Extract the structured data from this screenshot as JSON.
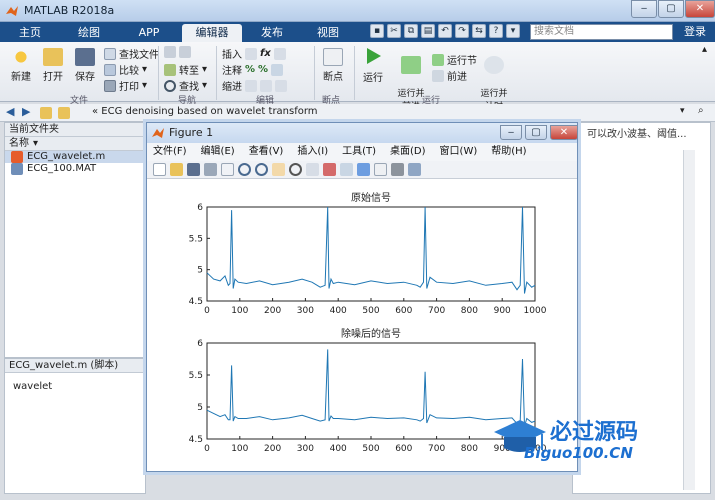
{
  "app": {
    "title": "MATLAB R2018a",
    "window_controls": [
      "‒",
      "▢",
      "✕"
    ]
  },
  "tabs": [
    {
      "label": "主页"
    },
    {
      "label": "绘图"
    },
    {
      "label": "APP"
    },
    {
      "label": "编辑器",
      "active": true
    },
    {
      "label": "发布"
    },
    {
      "label": "视图"
    }
  ],
  "search": {
    "placeholder": "搜索文档"
  },
  "login_label": "登录",
  "ribbon": {
    "file_group": {
      "new": "新建",
      "open": "打开",
      "save": "保存",
      "find_files": "查找文件",
      "compare": "比较",
      "print": "打印",
      "label": "文件"
    },
    "nav_group": {
      "goto": "转至",
      "find": "查找",
      "label": "导航"
    },
    "edit_group": {
      "insert": "插入",
      "comment": "注释",
      "indent": "缩进",
      "fx": "fx",
      "label": "编辑"
    },
    "breakpoint_group": {
      "breakpoint": "断点",
      "label": "断点"
    },
    "run_group": {
      "run": "运行",
      "run_advance": "运行并\n前进",
      "run_section": "运行节",
      "advance": "前进",
      "run_time": "运行并\n计时",
      "label": "运行"
    }
  },
  "address": {
    "path": "«  ECG denoising based on wavelet transform"
  },
  "left_panel": {
    "title": "当前文件夹",
    "column": "名称",
    "files": [
      {
        "name": "ECG_wavelet.m",
        "selected": true
      },
      {
        "name": "ECG_100.MAT",
        "selected": false
      }
    ]
  },
  "details": {
    "title": "ECG_wavelet.m  (脚本)",
    "content": "wavelet"
  },
  "right_panel": {
    "hint": "可以改小波基、阈值..."
  },
  "figure": {
    "title": "Figure 1",
    "menu": [
      "文件(F)",
      "编辑(E)",
      "查看(V)",
      "插入(I)",
      "工具(T)",
      "桌面(D)",
      "窗口(W)",
      "帮助(H)"
    ]
  },
  "chart_data": [
    {
      "type": "line",
      "title": "原始信号",
      "xlim": [
        0,
        1000
      ],
      "ylim": [
        4.5,
        6
      ],
      "xticks": [
        0,
        100,
        200,
        300,
        400,
        500,
        600,
        700,
        800,
        900,
        1000
      ],
      "yticks": [
        4.5,
        5,
        5.5,
        6
      ],
      "series": [
        {
          "x": [
            0,
            20,
            40,
            55,
            65,
            70,
            75,
            80,
            85,
            95,
            120,
            160,
            200,
            250,
            290,
            320,
            345,
            360,
            368,
            372,
            378,
            385,
            400,
            450,
            500,
            550,
            600,
            640,
            650,
            660,
            665,
            670,
            680,
            700,
            750,
            800,
            850,
            900,
            930,
            945,
            955,
            962,
            968,
            975,
            990,
            1000
          ],
          "y": [
            4.95,
            4.85,
            4.82,
            4.9,
            4.75,
            4.78,
            5.95,
            4.7,
            4.85,
            4.8,
            4.78,
            4.82,
            4.76,
            4.8,
            4.85,
            4.8,
            4.72,
            4.75,
            6.0,
            4.7,
            4.85,
            4.78,
            4.8,
            4.76,
            4.82,
            4.78,
            4.8,
            4.75,
            4.72,
            4.8,
            6.0,
            4.7,
            4.88,
            4.8,
            4.78,
            4.82,
            4.75,
            4.78,
            4.8,
            4.68,
            4.75,
            6.0,
            4.62,
            4.8,
            4.72,
            4.75
          ],
          "color": "#1f77b4"
        }
      ]
    },
    {
      "type": "line",
      "title": "除噪后的信号",
      "xlim": [
        0,
        1000
      ],
      "ylim": [
        4.5,
        6
      ],
      "xticks": [
        0,
        100,
        200,
        300,
        400,
        500,
        600,
        700,
        800,
        900,
        1000
      ],
      "yticks": [
        4.5,
        5,
        5.5,
        6
      ],
      "series": [
        {
          "x": [
            0,
            20,
            40,
            55,
            65,
            70,
            75,
            80,
            85,
            95,
            120,
            160,
            200,
            250,
            290,
            320,
            345,
            360,
            368,
            372,
            378,
            385,
            400,
            450,
            500,
            550,
            600,
            640,
            650,
            660,
            665,
            670,
            680,
            700,
            750,
            800,
            850,
            900,
            930,
            945,
            955,
            962,
            968,
            975,
            990,
            1000
          ],
          "y": [
            4.95,
            4.9,
            4.85,
            4.88,
            4.8,
            4.8,
            5.65,
            4.78,
            4.85,
            4.82,
            4.82,
            4.85,
            4.8,
            4.83,
            4.87,
            4.82,
            4.78,
            4.8,
            5.9,
            4.78,
            4.86,
            4.82,
            4.82,
            4.8,
            4.84,
            4.82,
            4.83,
            4.8,
            4.78,
            4.82,
            5.55,
            4.75,
            4.88,
            4.83,
            4.82,
            4.84,
            4.8,
            4.82,
            4.83,
            4.74,
            4.78,
            5.75,
            4.7,
            4.82,
            4.76,
            4.78
          ],
          "color": "#1f77b4"
        }
      ]
    }
  ],
  "watermark": {
    "text1": "必过源码",
    "text2": "Biguo100.CN"
  },
  "colors": {
    "tabstrip": "#1c4f8a",
    "accent": "#2e7fd3",
    "line": "#1f77b4"
  }
}
